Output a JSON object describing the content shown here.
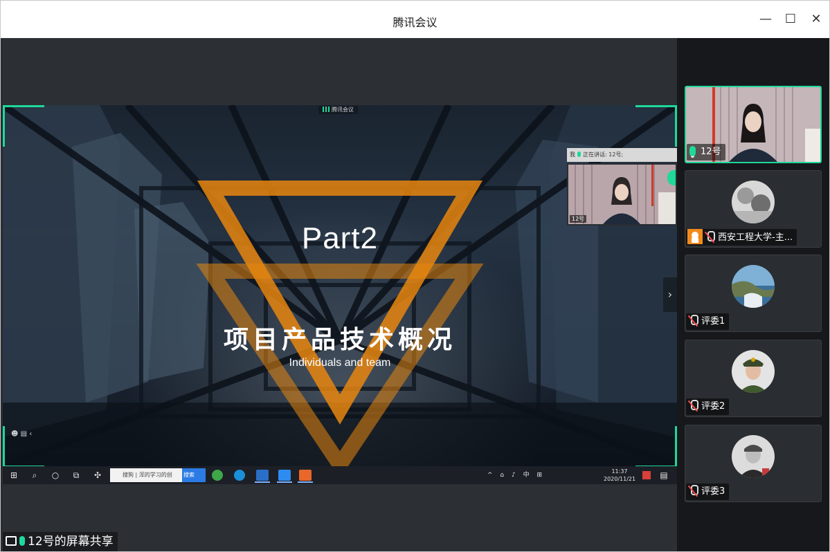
{
  "window": {
    "title": "腾讯会议",
    "minimize": "—",
    "maximize": "☐",
    "close": "✕"
  },
  "shared_screen": {
    "app_label": "腾讯会议",
    "slide": {
      "part": "Part2",
      "title": "项目产品技术概况",
      "subtitle": "Individuals and team"
    },
    "speaking_bar": {
      "me": "我",
      "speaking": "正在讲话: 12号;"
    },
    "pip_label": "12号",
    "next_arrow": "›",
    "taskbar": {
      "search_text": "搜狗 | 浑的学习的创",
      "search_button": "搜索",
      "tray": "^ ⌂ ♪ 中 ⊞",
      "time": "11:37",
      "date": "2020/11/21"
    }
  },
  "share_status": "12号的屏幕共享",
  "participants": [
    {
      "name": "12号",
      "mic": "on",
      "active": true
    },
    {
      "name": "西安工程大学-主...",
      "mic": "off",
      "host_badge": true
    },
    {
      "name": "评委1",
      "mic": "off"
    },
    {
      "name": "评委2",
      "mic": "off"
    },
    {
      "name": "评委3",
      "mic": "off"
    }
  ],
  "colors": {
    "accent_green": "#1ed99a",
    "triangle_orange": "#e8860f",
    "mute_red": "#ff4d4f"
  }
}
